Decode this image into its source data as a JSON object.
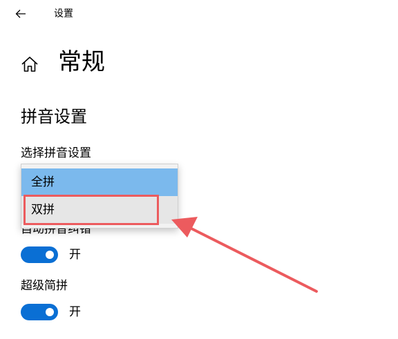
{
  "window": {
    "title": "设置",
    "back_icon": "back-arrow-icon"
  },
  "header": {
    "icon": "home-icon",
    "title": "常规"
  },
  "section": {
    "title": "拼音设置"
  },
  "pinyin_select": {
    "label": "选择拼音设置",
    "options": [
      "全拼",
      "双拼"
    ],
    "hovered": "全拼",
    "annotated": "双拼"
  },
  "settings": [
    {
      "label": "自动拼音纠错",
      "state": "开",
      "on": true
    },
    {
      "label": "超级简拼",
      "state": "开",
      "on": true
    }
  ],
  "colors": {
    "accent": "#0a6fd4",
    "hover_option": "#7bb9ed",
    "annotation": "#ec5b5e"
  }
}
